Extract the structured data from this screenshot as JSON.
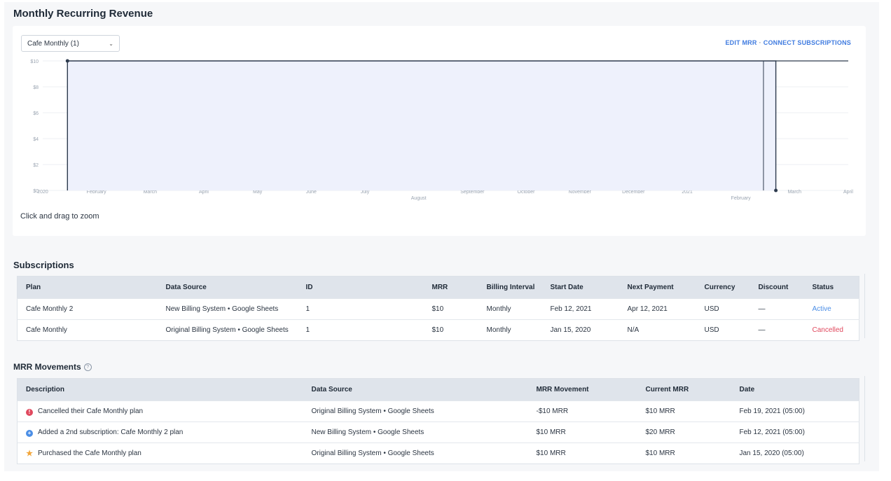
{
  "page": {
    "mrr_title": "Monthly Recurring Revenue",
    "subscriptions_title": "Subscriptions",
    "movements_title": "MRR Movements",
    "help_glyph": "?"
  },
  "chart_controls": {
    "selected_plan": "Cafe Monthly (1)",
    "edit_mrr": "EDIT MRR",
    "separator": "·",
    "connect_subscriptions": "CONNECT SUBSCRIPTIONS",
    "zoom_hint": "Click and drag to zoom"
  },
  "chart_data": {
    "type": "area",
    "ytick_labels": [
      "$0",
      "$2",
      "$4",
      "$6",
      "$8",
      "$10"
    ],
    "ylim": [
      0,
      10
    ],
    "xtick_labels": [
      "2020",
      "February",
      "March",
      "April",
      "May",
      "June",
      "July",
      "August",
      "September",
      "October",
      "November",
      "December",
      "2021",
      "February",
      "March",
      "April"
    ],
    "xlim": [
      "2020-01-01",
      "2021-04-01"
    ],
    "series": [
      {
        "points": [
          {
            "x": "2020-01-15",
            "y": 0
          },
          {
            "x": "2020-01-15",
            "y": 10
          },
          {
            "x": "2021-02-12",
            "y": 10
          },
          {
            "x": "2021-02-12",
            "y": 10
          },
          {
            "x": "2021-02-19",
            "y": 10
          },
          {
            "x": "2021-02-19",
            "y": 0
          }
        ]
      }
    ],
    "fill_color": "#eef1fc",
    "line_color": "#2e3b4e",
    "grid": true
  },
  "subscriptions": {
    "columns": [
      "Plan",
      "Data Source",
      "ID",
      "MRR",
      "Billing Interval",
      "Start Date",
      "Next Payment",
      "Currency",
      "Discount",
      "Status"
    ],
    "rows": [
      [
        "Cafe Monthly 2",
        "New Billing System • Google Sheets",
        "1",
        "$10",
        "Monthly",
        "Feb 12, 2021",
        "Apr 12, 2021",
        "USD",
        "—",
        "Active"
      ],
      [
        "Cafe Monthly",
        "Original Billing System • Google Sheets",
        "1",
        "$10",
        "Monthly",
        "Jan 15, 2020",
        "N/A",
        "USD",
        "—",
        "Cancelled"
      ]
    ]
  },
  "movements": {
    "columns": [
      "Description",
      "Data Source",
      "MRR Movement",
      "Current MRR",
      "Date"
    ],
    "rows": [
      {
        "icon": "cancel-icon",
        "glyph": "!",
        "description": "Cancelled their Cafe Monthly plan",
        "source": "Original Billing System • Google Sheets",
        "movement": "-$10 MRR",
        "current": "$10 MRR",
        "date": "Feb 19, 2021 (05:00)"
      },
      {
        "icon": "add-subscription-icon",
        "glyph": "+",
        "description": "Added a 2nd subscription: Cafe Monthly 2 plan",
        "source": "New Billing System • Google Sheets",
        "movement": "$10 MRR",
        "current": "$20 MRR",
        "date": "Feb 12, 2021 (05:00)"
      },
      {
        "icon": "star-icon",
        "glyph": "★",
        "description": "Purchased the Cafe Monthly plan",
        "source": "Original Billing System • Google Sheets",
        "movement": "$10 MRR",
        "current": "$10 MRR",
        "date": "Jan 15, 2020 (05:00)"
      }
    ]
  },
  "colors": {
    "status_active": "#4b8ee6",
    "status_cancelled": "#e0495e",
    "accent_link": "#3f7be0"
  }
}
